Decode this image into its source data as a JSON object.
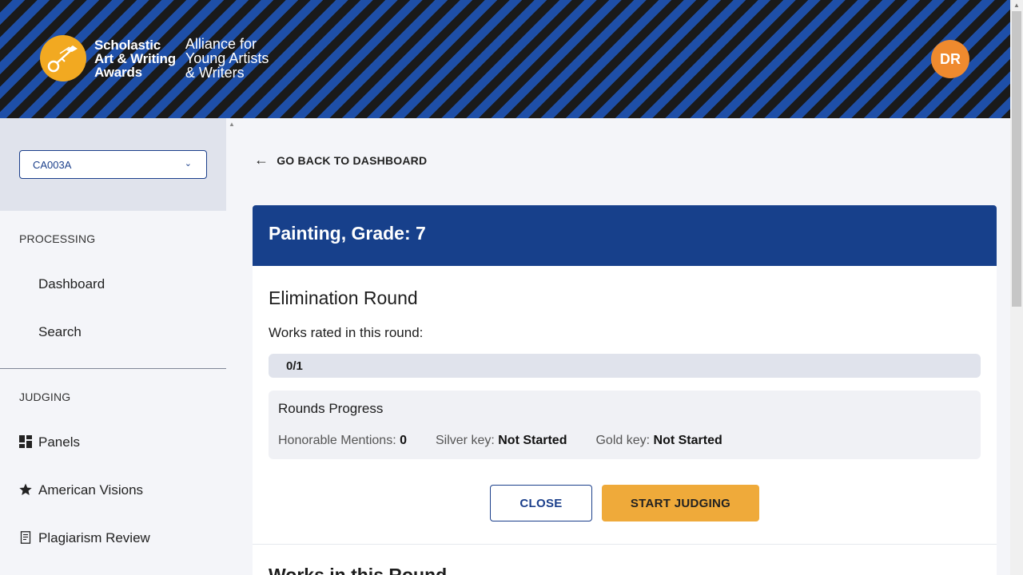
{
  "header": {
    "logo_name_lines": [
      "Scholastic",
      "Art & Writing",
      "Awards"
    ],
    "logo_tag_lines": [
      "Alliance for",
      "Young Artists",
      "& Writers"
    ],
    "avatar_initials": "DR",
    "accent_blue": "#1e4fa8",
    "accent_orange": "#ef8a2e"
  },
  "sidebar": {
    "select_value": "CA003A",
    "processing_label": "PROCESSING",
    "processing_items": [
      {
        "label": "Dashboard"
      },
      {
        "label": "Search"
      }
    ],
    "judging_label": "JUDGING",
    "judging_items": [
      {
        "label": "Panels",
        "icon": "grid-icon"
      },
      {
        "label": "American Visions",
        "icon": "star-icon"
      },
      {
        "label": "Plagiarism Review",
        "icon": "document-icon"
      }
    ]
  },
  "main": {
    "back_label": "GO BACK TO DASHBOARD",
    "card_title": "Painting, Grade: 7",
    "round_title": "Elimination Round",
    "works_rated_label": "Works rated in this round:",
    "progress_text": "0/1",
    "rounds_progress_title": "Rounds Progress",
    "stats": {
      "honorable_label": "Honorable Mentions:",
      "honorable_value": "0",
      "silver_label": "Silver key:",
      "silver_value": "Not Started",
      "gold_label": "Gold key:",
      "gold_value": "Not Started"
    },
    "close_label": "CLOSE",
    "start_label": "START JUDGING",
    "works_in_round_title": "Works in this Round"
  }
}
